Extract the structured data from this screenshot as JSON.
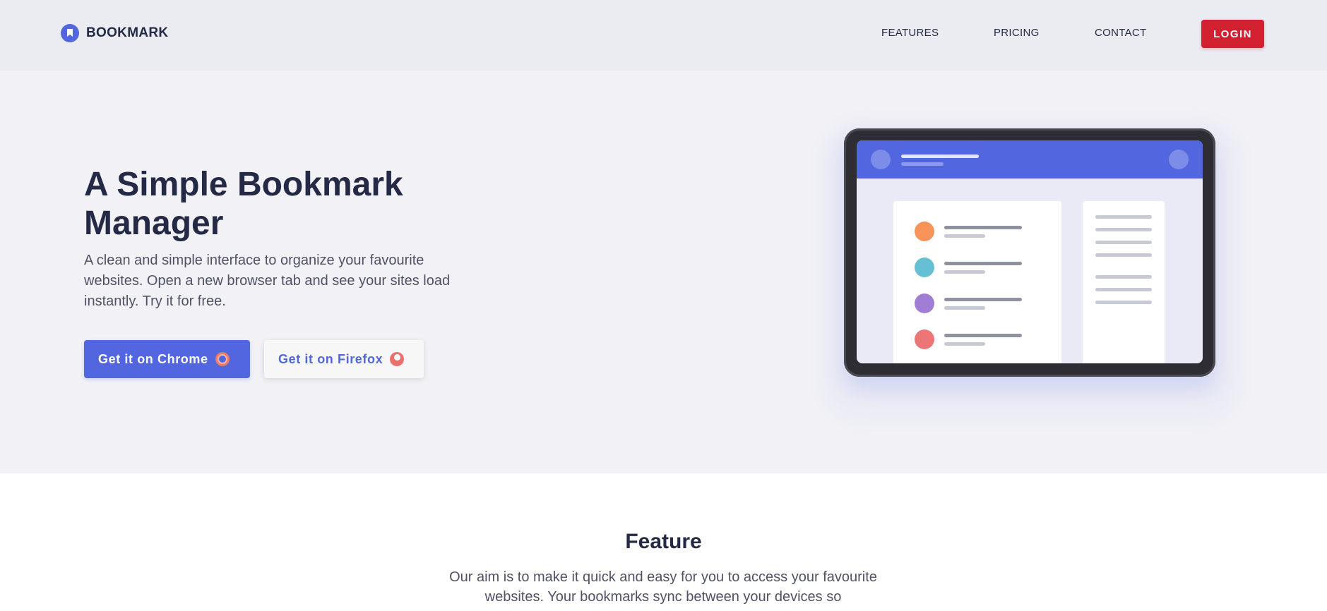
{
  "header": {
    "logo_text": "BOOKMARK",
    "nav": [
      {
        "label": "FEATURES"
      },
      {
        "label": "PRICING"
      },
      {
        "label": "CONTACT"
      }
    ],
    "login_label": "LOGIN"
  },
  "hero": {
    "title": "A Simple Bookmark Manager",
    "description": "A clean and simple interface to organize your favourite websites. Open a new browser tab and see your sites load instantly. Try it for free.",
    "chrome_button": "Get it on Chrome",
    "firefox_button": "Get it on Firefox"
  },
  "feature": {
    "title": "Feature",
    "description": "Our aim is to make it quick and easy for you to access your favourite websites. Your bookmarks sync between your devices so"
  },
  "colors": {
    "primary": "#5267df",
    "accent": "#d1202f",
    "dark": "#242a45",
    "dot_orange": "#f8945a",
    "dot_teal": "#66c0d3",
    "dot_purple": "#a17ed6",
    "dot_red": "#ec7576"
  },
  "icons": {
    "logo": "bookmark-logo-icon",
    "chrome": "chrome-icon",
    "firefox": "firefox-icon"
  }
}
